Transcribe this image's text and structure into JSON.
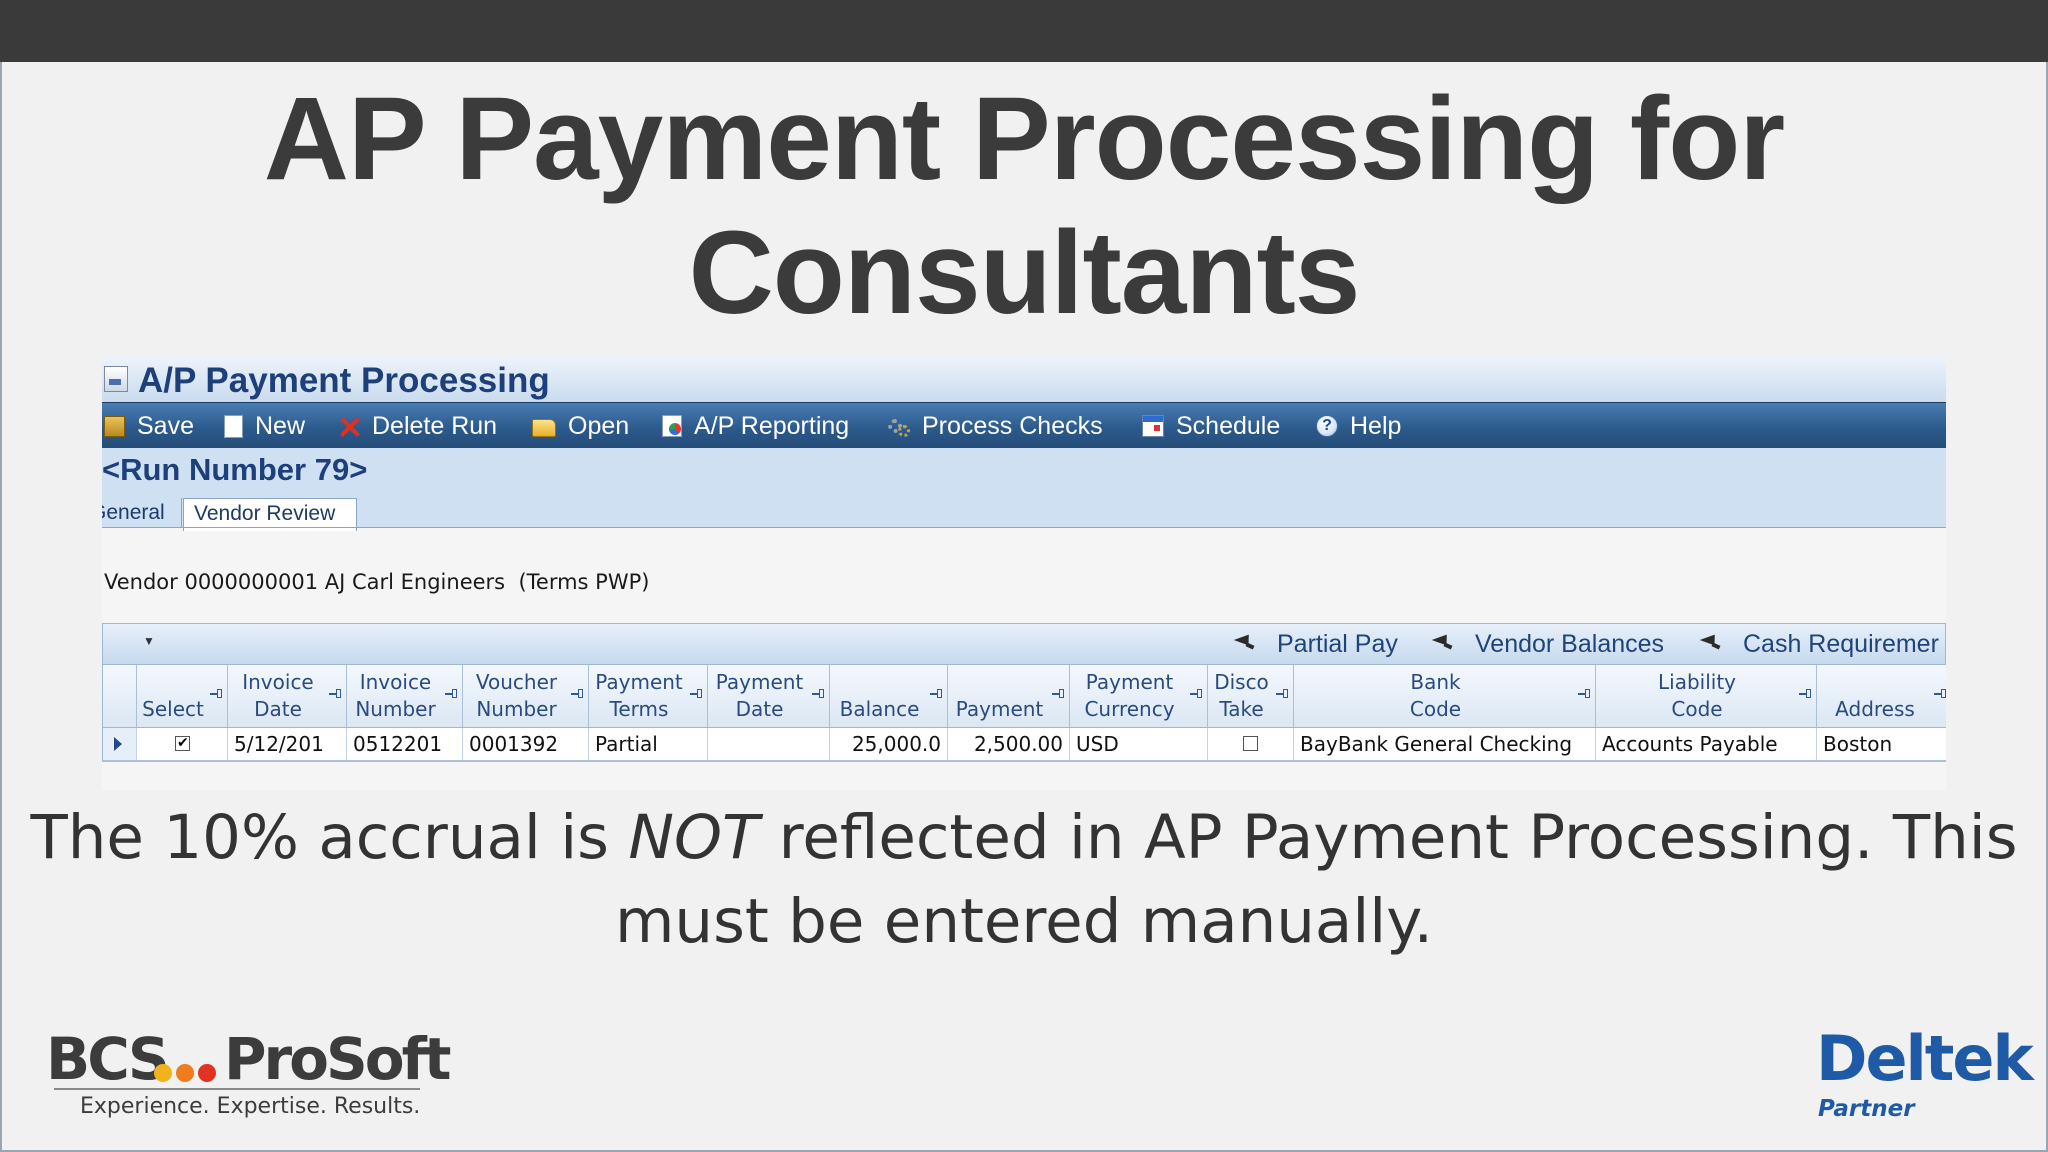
{
  "slide": {
    "title_line1": "AP Payment Processing for",
    "title_line2": "Consultants",
    "caption_part1": "The 10% accrual is ",
    "caption_emphasis": "NOT",
    "caption_part2": " reflected in AP Payment Processing. This",
    "caption_line2": "must be entered manually."
  },
  "app": {
    "title": "A/P Payment Processing",
    "toolbar": [
      {
        "label": "Save",
        "icon": "save-icon"
      },
      {
        "label": "New",
        "icon": "new-document-icon"
      },
      {
        "label": "Delete Run",
        "icon": "delete-icon"
      },
      {
        "label": "Open",
        "icon": "folder-open-icon"
      },
      {
        "label": "A/P Reporting",
        "icon": "report-icon"
      },
      {
        "label": "Process Checks",
        "icon": "gears-icon"
      },
      {
        "label": "Schedule",
        "icon": "calendar-icon"
      },
      {
        "label": "Help",
        "icon": "help-icon"
      }
    ],
    "run_number": "<Run Number 79>",
    "tabs": [
      {
        "label": "General"
      },
      {
        "label": "Vendor Review",
        "active": true
      }
    ],
    "vendor_line": "Vendor 0000000001 AJ Carl Engineers  (Terms PWP)",
    "grid_actions": [
      {
        "label": "Partial Pay"
      },
      {
        "label": "Vendor Balances"
      },
      {
        "label": "Cash Requiremer"
      }
    ],
    "grid": {
      "columns": [
        "Select",
        "Invoice\nDate",
        "Invoice\nNumber",
        "Voucher\nNumber",
        "Payment\nTerms",
        "Payment\nDate",
        "Balance",
        "Payment",
        "Payment\nCurrency",
        "Disco\nTake",
        "Bank\nCode",
        "Liability\nCode",
        "Address"
      ],
      "row": {
        "select_checked": true,
        "invoice_date": "5/12/201",
        "invoice_number": "0512201",
        "voucher_number": "0001392",
        "payment_terms": "Partial",
        "payment_date": "",
        "balance": "25,000.0",
        "payment": "2,500.00",
        "currency": "USD",
        "disco_take_checked": false,
        "bank_code": "BayBank General Checking",
        "liability_code": "Accounts Payable",
        "address": "Boston"
      }
    }
  },
  "logos": {
    "bcs_left": "BCS",
    "bcs_right": "ProSoft",
    "bcs_tagline": "Experience. Expertise. Results.",
    "bcs_dot_colors": [
      "#f2b21b",
      "#f07c1e",
      "#e23223"
    ],
    "deltek": "Deltek",
    "deltek_sub": "Partner"
  },
  "colors": {
    "title_text": "#3b3b3b",
    "toolbar_bg": "#2c5a8c",
    "header_text": "#1d3f7a",
    "deltek_blue": "#1f5aa6"
  }
}
